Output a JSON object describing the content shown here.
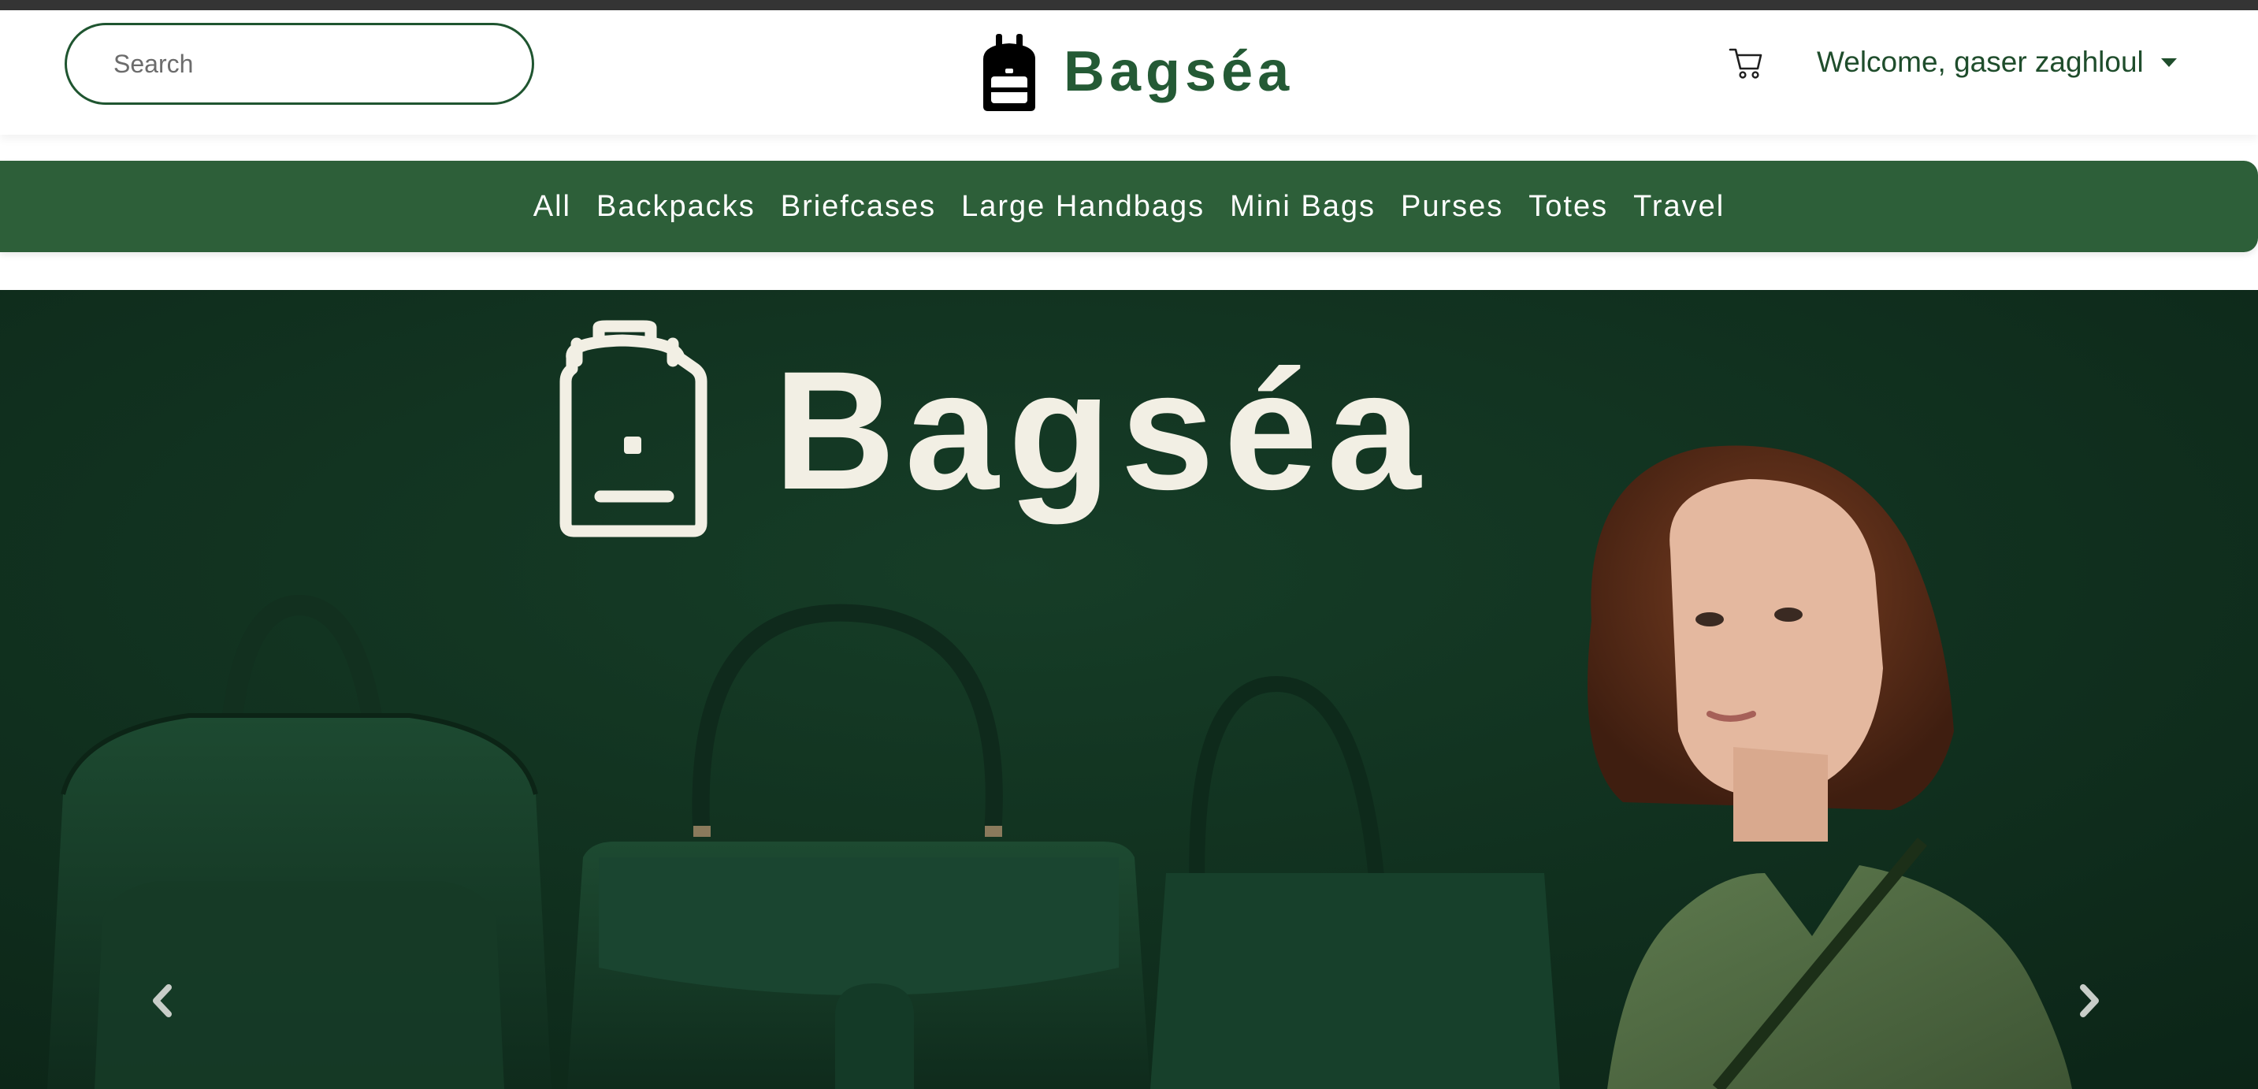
{
  "header": {
    "search": {
      "placeholder": "Search",
      "value": ""
    },
    "brand": {
      "name": "Bagséa",
      "logo_icon": "backpack-icon"
    },
    "cart_icon": "shopping-cart-icon",
    "user_menu": {
      "label": "Welcome, gaser zaghloul",
      "icon": "caret-down-icon"
    }
  },
  "categories": [
    "All",
    "Backpacks",
    "Briefcases",
    "Large Handbags",
    "Mini Bags",
    "Purses",
    "Totes",
    "Travel"
  ],
  "hero": {
    "banner_title": "Bagséa",
    "banner_logo_icon": "backpack-outline-icon",
    "prev_icon": "chevron-left-icon",
    "next_icon": "chevron-right-icon"
  },
  "colors": {
    "brand_green": "#245a35",
    "nav_green": "#2d5f39",
    "hero_bg": "#0f2e1d",
    "topbar": "#343434",
    "banner_text": "#f2efe4"
  }
}
